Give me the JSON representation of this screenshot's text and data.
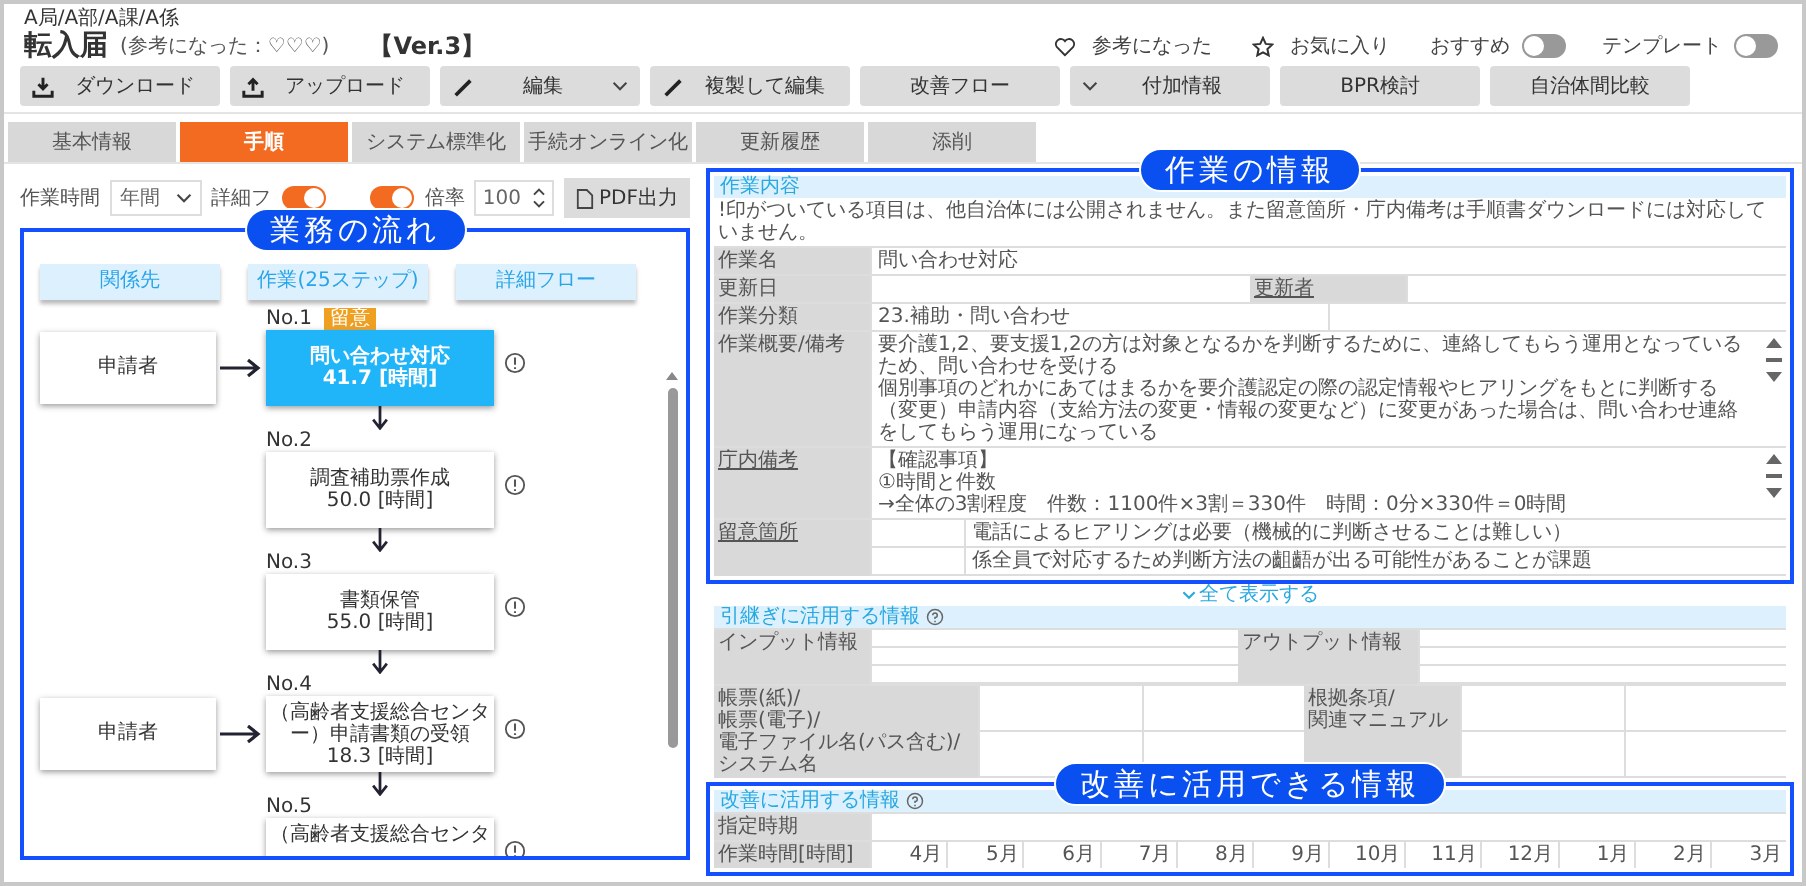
{
  "breadcrumb": "A局/A部/A課/A係",
  "title": "転入届",
  "rating": "(参考になった：♡♡♡)",
  "version": "【Ver.3】",
  "actions": [
    {
      "kind": "heart",
      "label": "参考になった"
    },
    {
      "kind": "star",
      "label": "お気に入り"
    }
  ],
  "toggles": [
    {
      "label": "おすすめ",
      "on": false
    },
    {
      "label": "テンプレート",
      "on": false
    }
  ],
  "toolbar": [
    {
      "label": "ダウンロード",
      "kind": "download"
    },
    {
      "label": "アップロード",
      "kind": "upload"
    },
    {
      "label": "編集",
      "kind": "pencil",
      "dropdown": true
    },
    {
      "label": "複製して編集",
      "kind": "pencil"
    },
    {
      "label": "改善フロー",
      "kind": "plain"
    },
    {
      "label": "付加情報",
      "kind": "chevron"
    },
    {
      "label": "BPR検討",
      "kind": "plain"
    },
    {
      "label": "自治体間比較",
      "kind": "plain"
    }
  ],
  "tabs": [
    {
      "label": "基本情報",
      "selected": false
    },
    {
      "label": "手順",
      "selected": true
    },
    {
      "label": "システム標準化",
      "selected": false
    },
    {
      "label": "手続オンライン化",
      "selected": false
    },
    {
      "label": "更新履歴",
      "selected": false
    },
    {
      "label": "添削",
      "selected": false
    }
  ],
  "flow": {
    "callout": "業務の流れ",
    "controls": {
      "time_label": "作業時間",
      "time_value": "年間",
      "detail_label": "詳細フ",
      "detail_on": true,
      "second_on": true,
      "scale_label": "倍率",
      "scale_value": "100",
      "pdf_button": "PDF出力"
    },
    "columns": [
      "関係先",
      "作業(25ステップ)",
      "詳細フロー"
    ],
    "steps": [
      {
        "no": "No.1",
        "badge": "留意",
        "actor": "申請者",
        "title": "問い合わせ対応",
        "time": "41.7 [時間]",
        "selected": true
      },
      {
        "no": "No.2",
        "title": "調査補助票作成",
        "time": "50.0 [時間]",
        "selected": false
      },
      {
        "no": "No.3",
        "title": "書類保管",
        "time": "55.0 [時間]",
        "selected": false
      },
      {
        "no": "No.4",
        "actor": "申請者",
        "title": "（高齢者支援総合センター）申請書類の受領",
        "time": "18.3 [時間]",
        "selected": false
      },
      {
        "no": "No.5",
        "title": "（高齢者支援総合センタ",
        "selected": false
      }
    ]
  },
  "work_info": {
    "callout": "作業の情報",
    "header": "作業内容",
    "note": "!印がついている項目は、他自治体には公開されません。また留意箇所・庁内備考は手順書ダウンロードには対応していません。",
    "name_label": "作業名",
    "name_value": "問い合わせ対応",
    "updated_label": "更新日",
    "updater_label": "更新者",
    "category_label": "作業分類",
    "category_value": "23.補助・問い合わせ",
    "summary_label": "作業概要/備考",
    "summary_lines": [
      "要介護1,2、要支援1,2の方は対象となるかを判断するために、連絡してもらう運用となっているため、問い合わせを受ける",
      "個別事項のどれかにあてはまるかを要介護認定の際の認定情報やヒアリングをもとに判断する",
      "（変更）申請内容（支給方法の変更・情報の変更など）に変更があった場合は、問い合わせ連絡をしてもらう運用になっている"
    ],
    "internal_label": "庁内備考",
    "internal_lines": [
      "【確認事項】",
      "①時間と件数",
      "→全体の3割程度　件数：1100件×3割＝330件　時間：0分×330件＝0時間"
    ],
    "caution_label": "留意箇所",
    "caution_rows": [
      "電話によるヒアリングは必要（機械的に判断させることは難しい）",
      "係全員で対応するため判断方法の齟齬が出る可能性があることが課題"
    ],
    "expand_link": "全て表示する"
  },
  "handover": {
    "header": "引継ぎに活用する情報",
    "input_label": "インプット情報",
    "output_label": "アウトプット情報",
    "forms_label_lines": [
      "帳票(紙)/",
      "帳票(電子)/",
      "電子ファイル名(パス含む)/",
      "システム名"
    ],
    "basis_label_lines": [
      "根拠条項/",
      "関連マニュアル"
    ]
  },
  "improvement": {
    "callout": "改善に活用できる情報",
    "header": "改善に活用する情報",
    "period_label": "指定時期",
    "time_label": "作業時間[時間]",
    "months": [
      "4月",
      "5月",
      "6月",
      "7月",
      "8月",
      "9月",
      "10月",
      "11月",
      "12月",
      "1月",
      "2月",
      "3月"
    ]
  }
}
